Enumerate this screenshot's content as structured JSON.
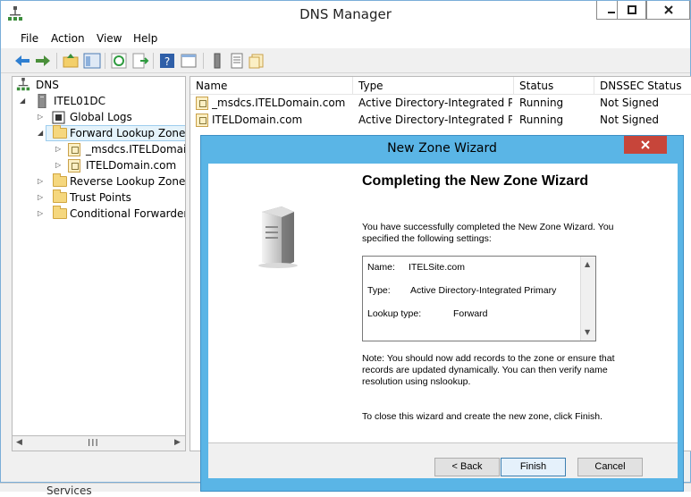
{
  "window": {
    "title": "DNS Manager"
  },
  "menu": [
    "File",
    "Action",
    "View",
    "Help"
  ],
  "tree": {
    "root": "DNS",
    "server": "ITEL01DC",
    "global_logs": "Global Logs",
    "forward_lookup_zones": "Forward Lookup Zones",
    "zone_msdcs": "_msdcs.ITELDomain.c",
    "zone_itel": "ITELDomain.com",
    "reverse_lookup_zones": "Reverse Lookup Zones",
    "trust_points": "Trust Points",
    "conditional_forwarders": "Conditional Forwarders"
  },
  "list": {
    "columns": [
      "Name",
      "Type",
      "Status",
      "DNSSEC Status"
    ],
    "rows": [
      {
        "name": "_msdcs.ITELDomain.com",
        "type": "Active Directory-Integrated Pr...",
        "status": "Running",
        "dnssec": "Not Signed"
      },
      {
        "name": "ITELDomain.com",
        "type": "Active Directory-Integrated Pr...",
        "status": "Running",
        "dnssec": "Not Signed"
      }
    ]
  },
  "status_bar": {
    "text": "Services"
  },
  "wizard": {
    "title": "New Zone Wizard",
    "heading": "Completing the New Zone Wizard",
    "intro": "You have successfully completed the New Zone Wizard. You specified the following settings:",
    "settings": {
      "name_label": "Name:",
      "name_value": "ITELSite.com",
      "type_label": "Type:",
      "type_value": "Active Directory-Integrated Primary",
      "lookup_label": "Lookup type:",
      "lookup_value": "Forward"
    },
    "note": "Note: You should now add records to the zone or ensure that records are updated dynamically. You can then verify name resolution using nslookup.",
    "finish_hint": "To close this wizard and create the new zone, click Finish.",
    "buttons": {
      "back": "< Back",
      "finish": "Finish",
      "cancel": "Cancel"
    }
  },
  "colors": {
    "wizard_frame": "#5ab5e6",
    "close_button": "#c7453a",
    "selection": "#e5f3fb"
  }
}
